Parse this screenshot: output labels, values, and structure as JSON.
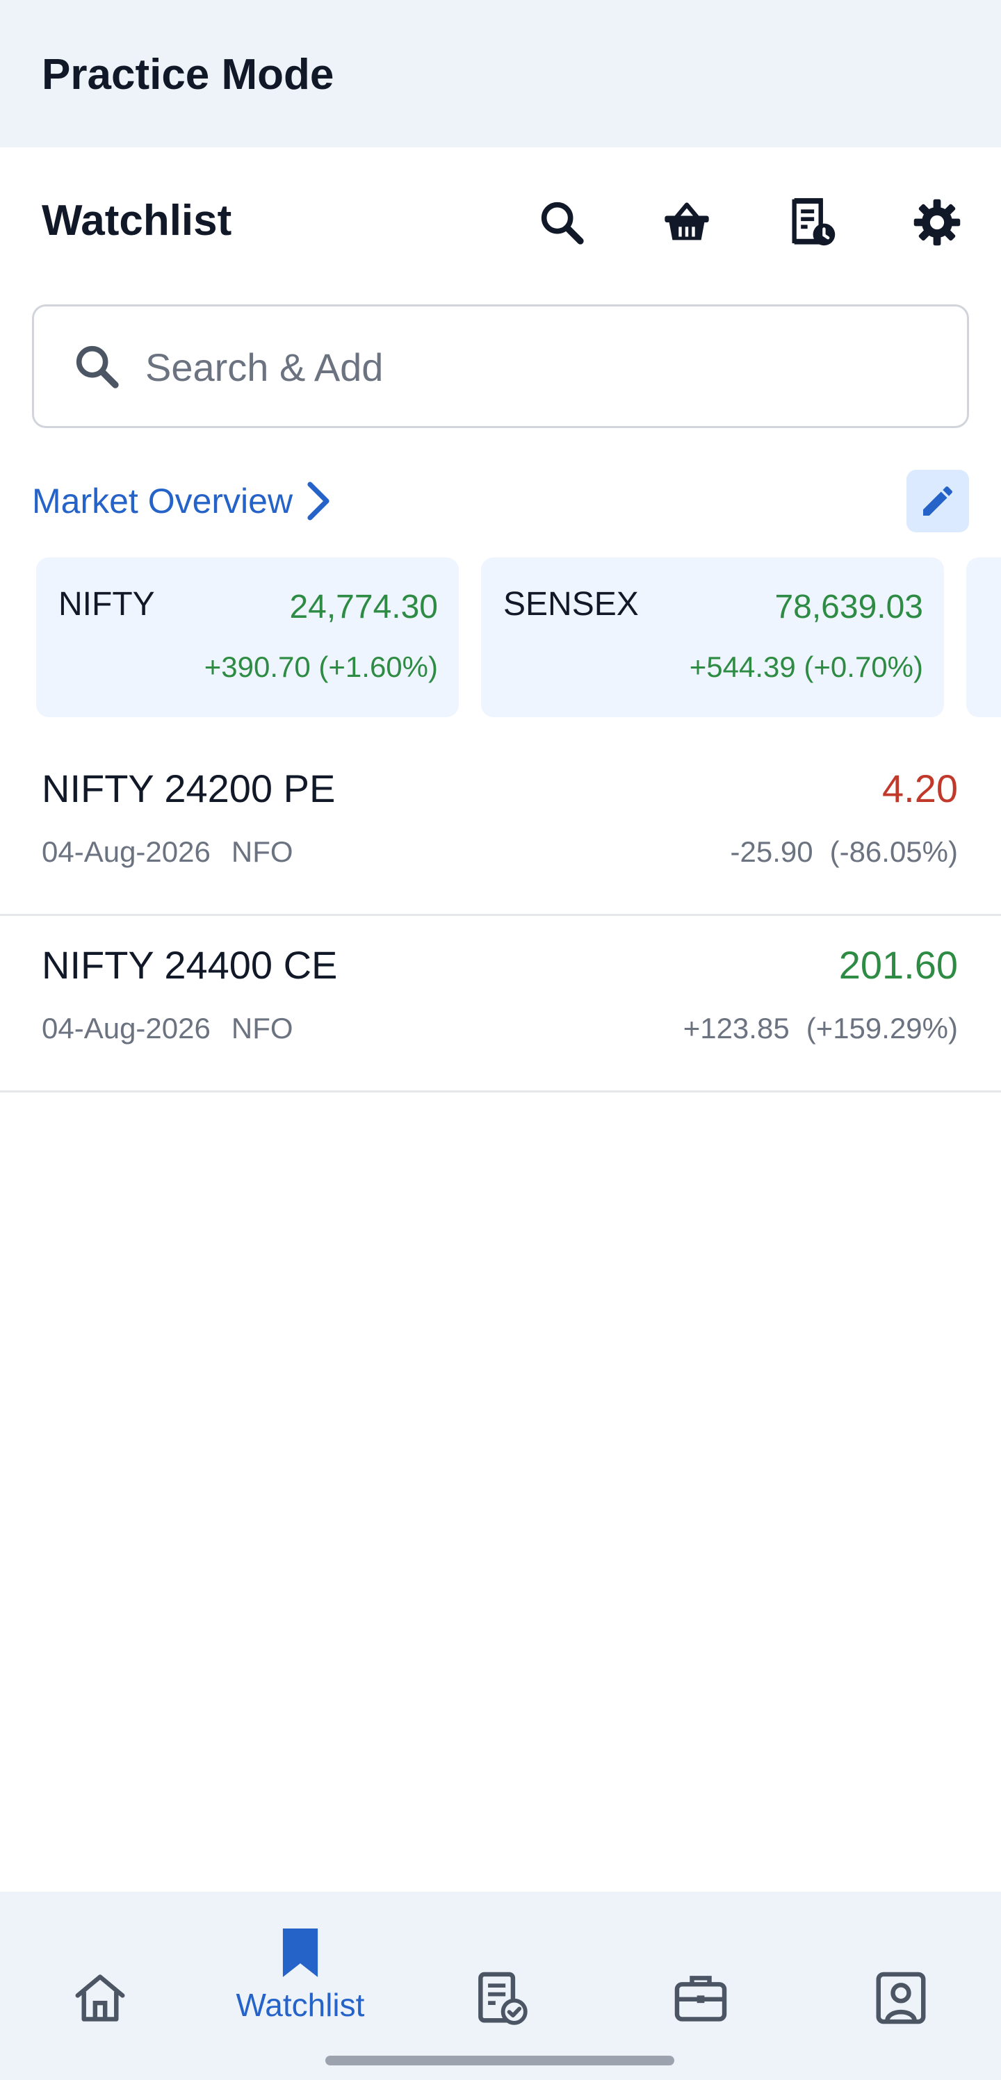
{
  "mode_title": "Practice Mode",
  "header": {
    "title": "Watchlist"
  },
  "search": {
    "placeholder": "Search & Add"
  },
  "market_overview": {
    "link_label": "Market Overview",
    "indices": [
      {
        "name": "NIFTY",
        "value": "24,774.30",
        "change": "+390.70 (+1.60%)"
      },
      {
        "name": "SENSEX",
        "value": "78,639.03",
        "change": "+544.39 (+0.70%)"
      }
    ]
  },
  "watchlist": [
    {
      "symbol": "NIFTY 24200 PE",
      "expiry": "04-Aug-2026",
      "exchange": "NFO",
      "ltp": "4.20",
      "change": "-25.90",
      "change_pct": "(-86.05%)",
      "trend": "down"
    },
    {
      "symbol": "NIFTY 24400 CE",
      "expiry": "04-Aug-2026",
      "exchange": "NFO",
      "ltp": "201.60",
      "change": "+123.85",
      "change_pct": "(+159.29%)",
      "trend": "up"
    }
  ],
  "colors": {
    "up": "#2e8b43",
    "down": "#c0392b",
    "accent": "#2563c9",
    "icon": "#4b5563"
  },
  "bottom_nav": {
    "active_label": "Watchlist"
  }
}
